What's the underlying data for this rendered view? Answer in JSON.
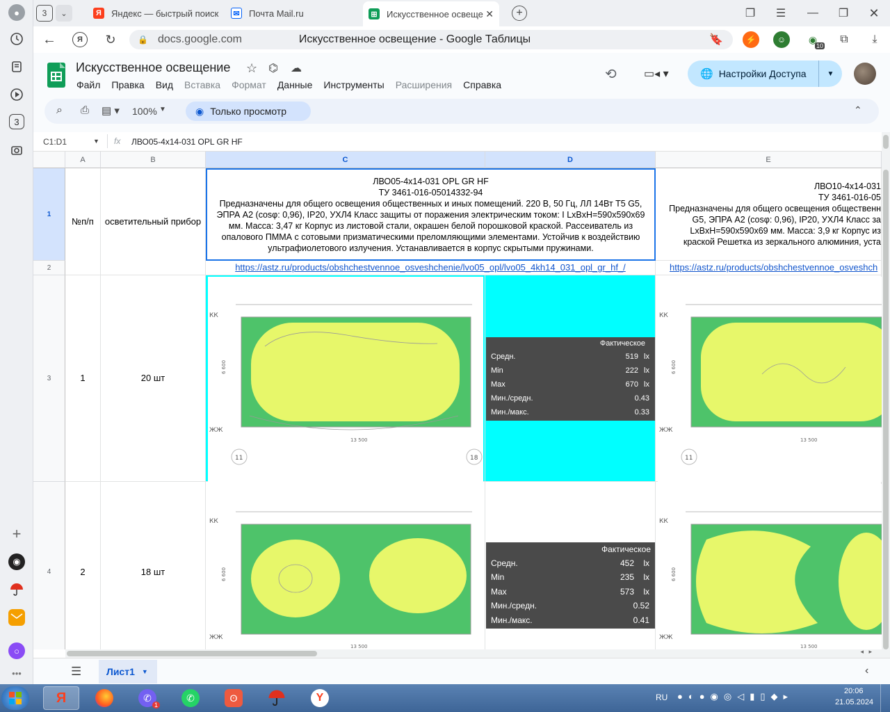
{
  "browser": {
    "tab_count": "3",
    "tabs": [
      {
        "label": "Яндекс — быстрый поиск"
      },
      {
        "label": "Почта Mail.ru"
      },
      {
        "label": "Искусственное освеще"
      }
    ],
    "domain": "docs.google.com",
    "page_title": "Искусственное освещение - Google Таблицы",
    "ext_badge": "10",
    "rail_badge": "3"
  },
  "doc": {
    "title": "Искусственное освещение",
    "menu": [
      "Файл",
      "Правка",
      "Вид",
      "Вставка",
      "Формат",
      "Данные",
      "Инструменты",
      "Расширения",
      "Справка"
    ],
    "share_label": "Настройки Доступа",
    "zoom": "100%",
    "mode_label": "Только просмотр"
  },
  "formula": {
    "cell_ref": "C1:D1",
    "fx": "fx",
    "value": "ЛВО05-4х14-031 OPL GR HF"
  },
  "grid": {
    "columns": [
      "A",
      "B",
      "C",
      "D",
      "E"
    ],
    "rows": [
      "1",
      "2",
      "3",
      "4"
    ],
    "a1": "№п/п",
    "b1": "осветительный прибор",
    "c1_lines": [
      "ЛВО05-4х14-031 OPL GR HF",
      "ТУ 3461-016-05014332-94",
      "Предназначены для общего освещения общественных и иных помещений. 220 В, 50 Гц, ЛЛ 14Вт Т5 G5, ЭПРА А2 (cosφ: 0,96), IP20, УХЛ4 Класс защиты от поражения электрическим током: I LxBxH=590x590x69 мм. Масса: 3,47 кг Корпус из листовой стали, окрашен белой порошковой краской. Рассеиватель из опалового ПММА с сотовыми призматическими преломляющими элементами. Устойчив к воздействию ультрафиолетового излучения. Устанавливается в корпус скрытыми пружинами."
    ],
    "e1_lines": [
      "ЛВО10-4х14-031",
      "ТУ 3461-016-05",
      "Предназначены для общего освещения общественн",
      "G5, ЭПРА А2 (cosφ: 0,96), IP20, УХЛ4 Класс за",
      "LxBxH=590x590x69 мм. Масса: 3,9 кг Корпус из",
      "краской Решетка из зеркального алюминия, уста"
    ],
    "c2_link": "https://astz.ru/products/obshchestvennoe_osveshchenie/lvo05_opl/lvo05_4kh14_031_opl_gr_hf_/",
    "e2_link": "https://astz.ru/products/obshchestvennoe_osveshch",
    "row3": {
      "a": "1",
      "b": "20 шт"
    },
    "row4": {
      "a": "2",
      "b": "18 шт"
    }
  },
  "plans": {
    "kk": "КК",
    "zhk": "ЖЖ",
    "width_dim": "13 500",
    "height_dim": "6 600",
    "axis_start": "11",
    "axis_end": "18"
  },
  "stats": [
    {
      "header": "Фактическое",
      "rows": [
        {
          "label": "Средн.",
          "value": "519",
          "unit": "lx"
        },
        {
          "label": "Min",
          "value": "222",
          "unit": "lx"
        },
        {
          "label": "Max",
          "value": "670",
          "unit": "lx"
        },
        {
          "label": "Мин./средн.",
          "value": "0.43",
          "unit": ""
        },
        {
          "label": "Мин./макс.",
          "value": "0.33",
          "unit": ""
        }
      ]
    },
    {
      "header": "Фактическое",
      "rows": [
        {
          "label": "Средн.",
          "value": "452",
          "unit": "lx"
        },
        {
          "label": "Min",
          "value": "235",
          "unit": "lx"
        },
        {
          "label": "Max",
          "value": "573",
          "unit": "lx"
        },
        {
          "label": "Мин./средн.",
          "value": "0.52",
          "unit": ""
        },
        {
          "label": "Мин./макс.",
          "value": "0.41",
          "unit": ""
        }
      ]
    }
  ],
  "sheet": {
    "tab_label": "Лист1"
  },
  "taskbar": {
    "lang": "RU",
    "time": "20:06",
    "date": "21.05.2024",
    "viber_badge": "1"
  },
  "colors": {
    "selection": "#00ffff",
    "plan_green": "#4ec36a",
    "plan_yellow": "#e7f76a",
    "stat_bg": "#4a4a4a",
    "share_bg": "#c2e7ff"
  }
}
